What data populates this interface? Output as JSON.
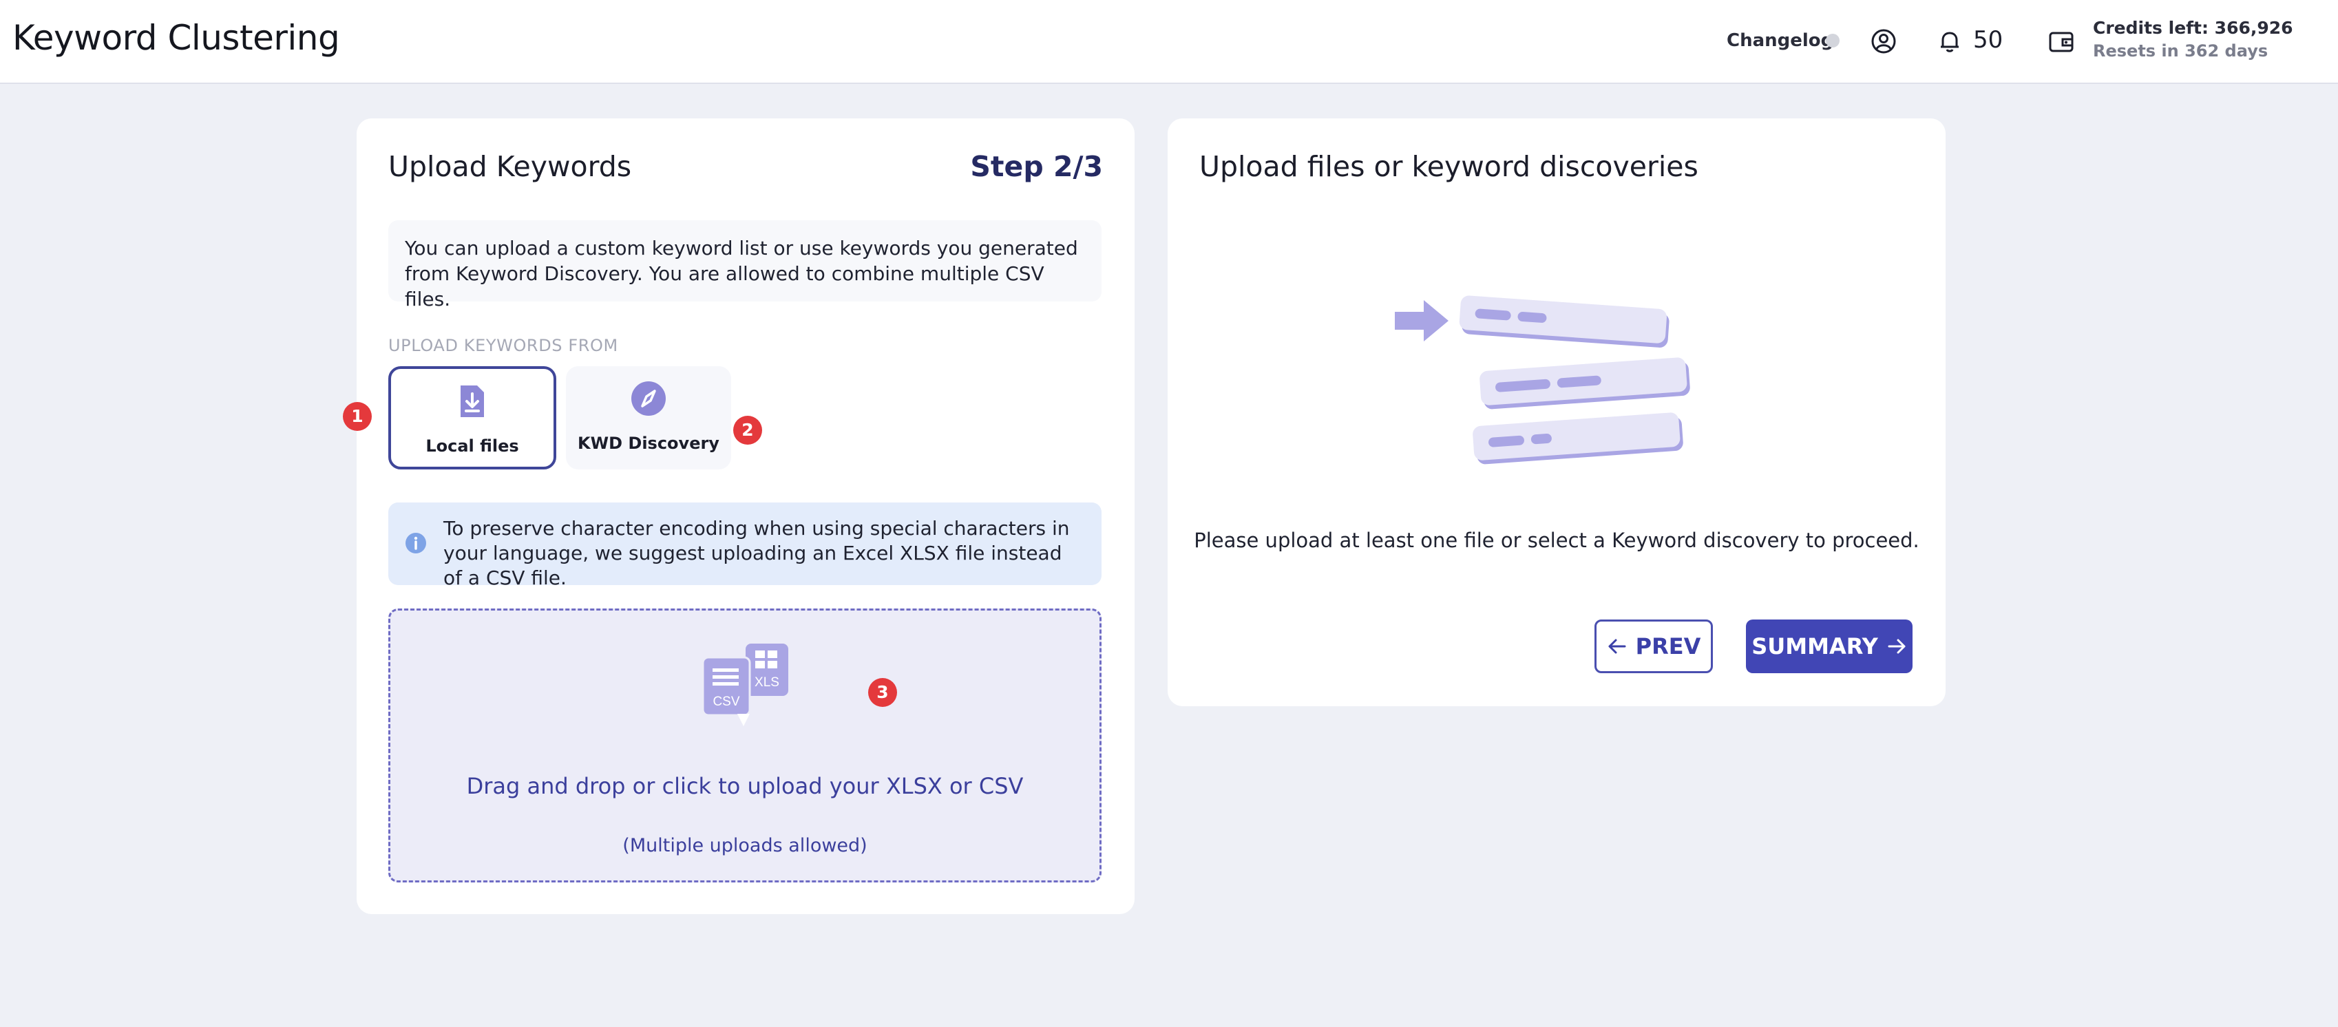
{
  "header": {
    "title": "Keyword Clustering",
    "changelog": "Changelog",
    "notifications_count": "50",
    "credits": "Credits left: 366,926",
    "resets": "Resets in 362 days",
    "icons": [
      "user-icon",
      "bell-icon",
      "wallet-icon"
    ]
  },
  "upload_card": {
    "title": "Upload Keywords",
    "step": "Step 2/3",
    "intro": "You can upload a custom keyword list or use keywords you generated from Keyword Discovery. You are allowed to combine multiple CSV files.",
    "source_label": "UPLOAD KEYWORDS FROM",
    "sources": [
      {
        "label": "Local files",
        "icon": "download-file-icon",
        "selected": true
      },
      {
        "label": "KWD Discovery",
        "icon": "compass-icon",
        "selected": false
      }
    ],
    "info": "To preserve character encoding when using special characters in your language, we suggest uploading an Excel XLSX file instead of a CSV file.",
    "dropzone": {
      "text": "Drag and drop or click to upload your XLSX or CSV",
      "subtext": "(Multiple uploads allowed)",
      "icon_csv": "CSV",
      "icon_xls": "XLS"
    },
    "badges": [
      "1",
      "2",
      "3"
    ]
  },
  "summary_card": {
    "title": "Upload files or keyword discoveries",
    "message": "Please upload at least one file or select a Keyword discovery to proceed.",
    "prev_label": "PREV",
    "summary_label": "SUMMARY"
  },
  "colors": {
    "accent": "#4146b5",
    "badge": "#e4393c",
    "background": "#eef0f6",
    "dropzone": "#ececf8"
  }
}
